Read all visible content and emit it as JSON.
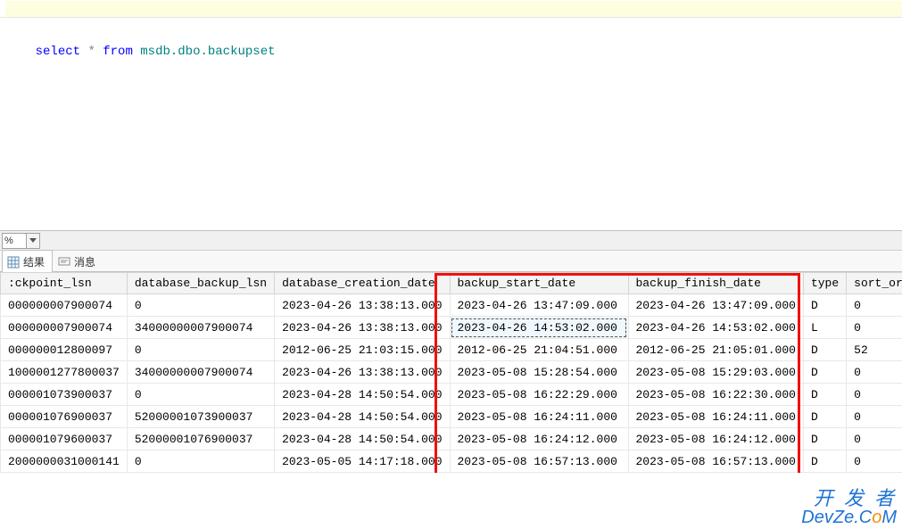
{
  "sql": {
    "select": "select",
    "star": "*",
    "from": "from",
    "ident": "msdb.dbo.backupset"
  },
  "zoom": {
    "value": "%"
  },
  "tabs": {
    "results": "结果",
    "messages": "消息"
  },
  "columns": {
    "ckpoint_lsn": ":ckpoint_lsn",
    "database_backup_lsn": "database_backup_lsn",
    "database_creation_date": "database_creation_date",
    "backup_start_date": "backup_start_date",
    "backup_finish_date": "backup_finish_date",
    "type": "type",
    "sort_order": "sort_order"
  },
  "rows": [
    {
      "ckpoint_lsn": "000000007900074",
      "database_backup_lsn": "0",
      "database_creation_date": "2023-04-26 13:38:13.000",
      "backup_start_date": "2023-04-26 13:47:09.000",
      "backup_finish_date": "2023-04-26 13:47:09.000",
      "type": "D",
      "sort_order": "0"
    },
    {
      "ckpoint_lsn": "000000007900074",
      "database_backup_lsn": "34000000007900074",
      "database_creation_date": "2023-04-26 13:38:13.000",
      "backup_start_date": "2023-04-26 14:53:02.000",
      "backup_finish_date": "2023-04-26 14:53:02.000",
      "type": "L",
      "sort_order": "0"
    },
    {
      "ckpoint_lsn": "000000012800097",
      "database_backup_lsn": "0",
      "database_creation_date": "2012-06-25 21:03:15.000",
      "backup_start_date": "2012-06-25 21:04:51.000",
      "backup_finish_date": "2012-06-25 21:05:01.000",
      "type": "D",
      "sort_order": "52"
    },
    {
      "ckpoint_lsn": "1000001277800037",
      "database_backup_lsn": "34000000007900074",
      "database_creation_date": "2023-04-26 13:38:13.000",
      "backup_start_date": "2023-05-08 15:28:54.000",
      "backup_finish_date": "2023-05-08 15:29:03.000",
      "type": "D",
      "sort_order": "0"
    },
    {
      "ckpoint_lsn": "000001073900037",
      "database_backup_lsn": "0",
      "database_creation_date": "2023-04-28 14:50:54.000",
      "backup_start_date": "2023-05-08 16:22:29.000",
      "backup_finish_date": "2023-05-08 16:22:30.000",
      "type": "D",
      "sort_order": "0"
    },
    {
      "ckpoint_lsn": "000001076900037",
      "database_backup_lsn": "52000001073900037",
      "database_creation_date": "2023-04-28 14:50:54.000",
      "backup_start_date": "2023-05-08 16:24:11.000",
      "backup_finish_date": "2023-05-08 16:24:11.000",
      "type": "D",
      "sort_order": "0"
    },
    {
      "ckpoint_lsn": "000001079600037",
      "database_backup_lsn": "52000001076900037",
      "database_creation_date": "2023-04-28 14:50:54.000",
      "backup_start_date": "2023-05-08 16:24:12.000",
      "backup_finish_date": "2023-05-08 16:24:12.000",
      "type": "D",
      "sort_order": "0"
    },
    {
      "ckpoint_lsn": "2000000031000141",
      "database_backup_lsn": "0",
      "database_creation_date": "2023-05-05 14:17:18.000",
      "backup_start_date": "2023-05-08 16:57:13.000",
      "backup_finish_date": "2023-05-08 16:57:13.000",
      "type": "D",
      "sort_order": "0"
    }
  ],
  "selected": {
    "row": 1,
    "col": "backup_start_date"
  },
  "watermark": {
    "line1": "开 发 者",
    "line2_pre": "DevZe.C",
    "line2_o": "o",
    "line2_post": "M"
  }
}
